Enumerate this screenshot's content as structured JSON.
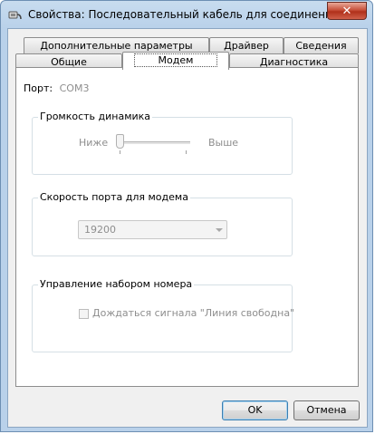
{
  "window": {
    "title": "Свойства: Последовательный кабель для соединения комп...",
    "close_glyph": "✕"
  },
  "tabs": {
    "row_top": [
      {
        "label": "Дополнительные параметры связи"
      },
      {
        "label": "Драйвер"
      },
      {
        "label": "Сведения"
      }
    ],
    "row_bottom": [
      {
        "label": "Общие"
      },
      {
        "label": "Модем"
      },
      {
        "label": "Диагностика"
      }
    ],
    "active": "Модем"
  },
  "port": {
    "label": "Порт:",
    "value": "COM3"
  },
  "speaker_volume": {
    "legend": "Громкость динамика",
    "low_label": "Ниже",
    "high_label": "Выше",
    "level": 0
  },
  "port_speed": {
    "legend": "Скорость порта для модема",
    "selected": "19200"
  },
  "dial_control": {
    "legend": "Управление набором номера",
    "wait_dialtone_label": "Дождаться сигнала \"Линия свободна\"",
    "wait_dialtone_checked": false
  },
  "buttons": {
    "ok": "OK",
    "cancel": "Отмена"
  },
  "colors": {
    "titlebar": "#b9d1ea",
    "close_button": "#c7503a",
    "disabled_text": "#8e8e8e"
  }
}
